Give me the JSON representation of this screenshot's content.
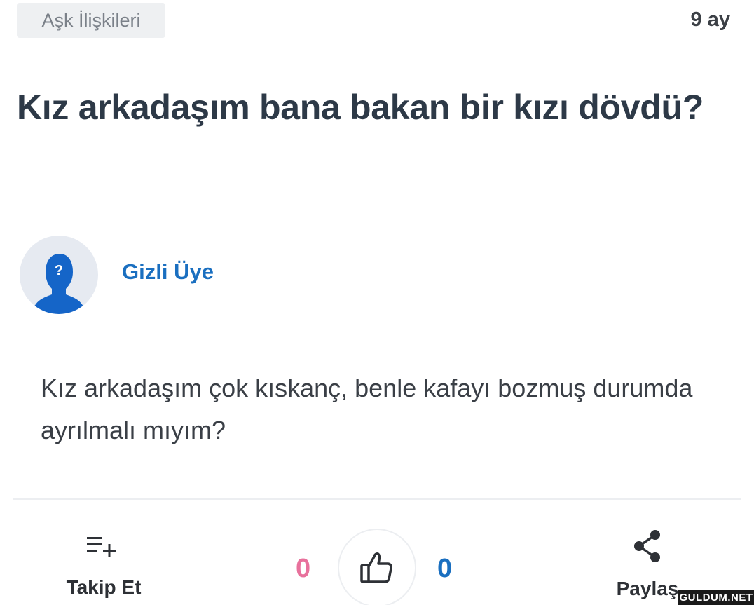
{
  "header": {
    "category": "Aşk İlişkileri",
    "time_ago": "9 ay"
  },
  "question": {
    "title": "Kız arkadaşım bana bakan bir kızı dövdü?",
    "body": "Kız arkadaşım çok kıskanç, benle kafayı bozmuş durumda ayrılmalı mıyım?"
  },
  "author": {
    "name": "Gizli Üye",
    "avatar_icon": "anonymous-user-icon",
    "avatar_glyph": "?"
  },
  "actions": {
    "follow_label": "Takip Et",
    "follow_icon": "add-to-list-icon",
    "dislike_count": "0",
    "like_count": "0",
    "like_icon": "thumbs-up-icon",
    "share_label": "Paylaş",
    "share_icon": "share-icon"
  },
  "watermark": "GULDUM.NET",
  "colors": {
    "title": "#2d3947",
    "author": "#1a6fc0",
    "like_count": "#1a6fc0",
    "dislike_count": "#e8719c",
    "chip_bg": "#eef0f2"
  }
}
